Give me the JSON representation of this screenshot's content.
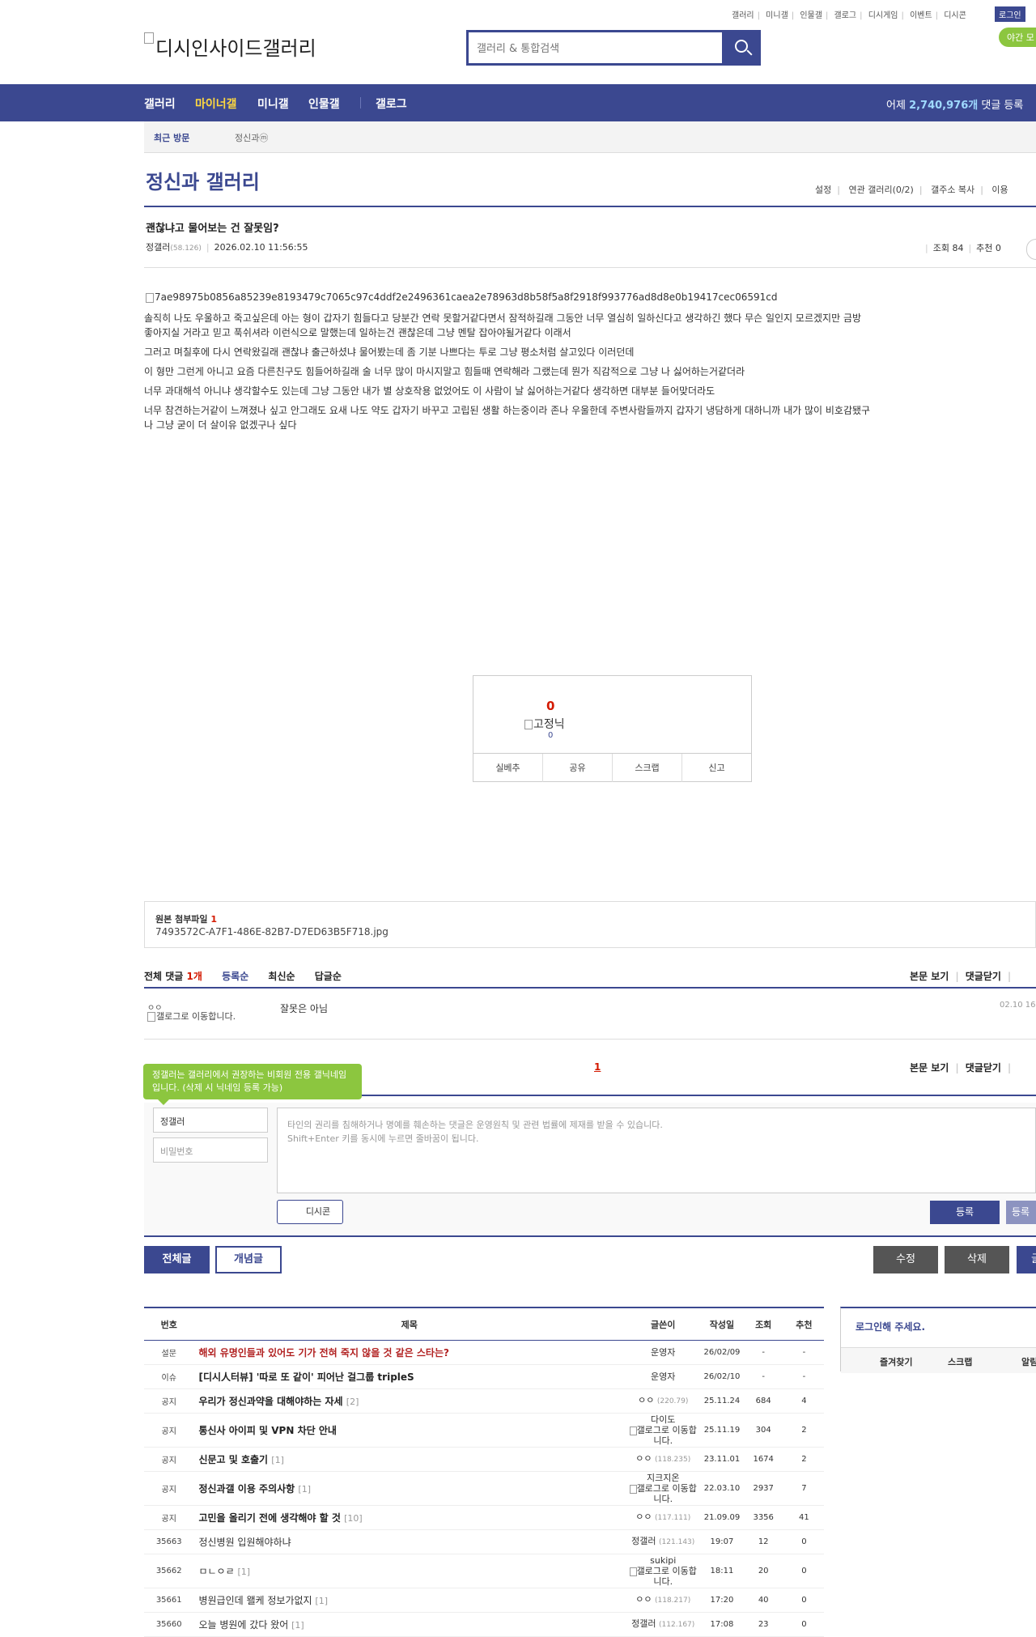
{
  "top_links": [
    "갤러리",
    "미니갤",
    "인물갤",
    "갤로그",
    "디시게임",
    "이벤트",
    "디시콘"
  ],
  "login_label": "로그인",
  "night_mode_label": "야간 모",
  "logo_alt": "디시인사이드갤러리",
  "search": {
    "placeholder": "갤러리 & 통합검색"
  },
  "nav": {
    "items": [
      "갤러리",
      "마이너갤",
      "미니갤",
      "인물갤",
      "갤로그"
    ],
    "active": "마이너갤",
    "stat_prefix": "어제",
    "stat_number": "2,740,976",
    "stat_unit": "개",
    "stat_suffix": "댓글 등록"
  },
  "recent_visit": {
    "label": "최근 방문",
    "item": "정신과ⓜ"
  },
  "gallery": {
    "title": "정신과 갤러리",
    "options": [
      "설정",
      "연관 갤러리(0/2)",
      "갤주소 복사",
      "이용"
    ]
  },
  "post": {
    "title": "괜찮냐고 물어보는 건 잘못임?",
    "author": "정갤러",
    "author_ip": "(58.126)",
    "datetime": "2026.02.10 11:56:55",
    "views_label": "조회 84",
    "recommend_label": "추천 0",
    "image_alt": "7ae98975b0856a85239e8193479c7065c97c4ddf2e2496361caea2e78963d8b58f5a8f2918f993776ad8d8e0b19417cec06591cd",
    "paragraphs": [
      "솔직히 나도 우울하고 죽고싶은데 아는 형이 갑자기 힘들다고 당분간 연락 못할거같다면서 잠적하길래 그동안 너무 열심히 일하신다고 생각하긴 했다 무슨 일인지 모르겠지만 금방 좋아지실 거라고 믿고 푹쉬셔라 이런식으로 말했는데 일하는건 괜찮은데 그냥 멘탈 잡아야될거같다 이래서",
      "그러고 며칠후에 다시 연락왔길래 괜찮냐 출근하셨냐 물어봤는데 좀 기분 나쁘다는 투로 그냥 평소처럼 살고있다 이러던데",
      "이 형만 그런게 아니고 요즘 다른친구도 힘들어하길래 술 너무 많이 마시지말고 힘들때 연락해라 그랬는데 뭔가 직감적으로 그냥 나 싫어하는거같더라",
      "너무 과대해석 아니냐 생각할수도 있는데 그냥 그동안 내가 별 상호작용 없었어도 이 사람이 날 싫어하는거같다 생각하면 대부분 들어맞더라도",
      "너무 참견하는거같이 느껴졌나 싶고 안그래도 요새 나도 약도 갑자기 바꾸고 고립된 생활 하는중이라 존나 우울한데 주변사람들까지 갑자기 냉담하게 대하니까 내가 많이 비호감됐구나 그냥 굳이 더 살이유 없겠구나 싶다"
    ]
  },
  "recommend": {
    "count": "0",
    "fixed_alt": "고정닉",
    "fixed_count": "0",
    "buttons": [
      "실베추",
      "공유",
      "스크랩",
      "신고"
    ]
  },
  "attachment": {
    "label": "원본 첨부파일",
    "count": "1",
    "filename": "7493572C-A7F1-486E-82B7-D7ED63B5F718.jpg"
  },
  "comments": {
    "total_label": "전체 댓글",
    "total_count": "1개",
    "sorts": [
      "등록순",
      "최신순",
      "답글순"
    ],
    "right_actions": [
      "본문 보기",
      "댓글닫기"
    ],
    "items": [
      {
        "nick": "ㅇㅇ",
        "img_alt": "갤로그로 이동합니다.",
        "text": "잘못은 아님",
        "date": "02.10 16"
      }
    ],
    "page": "1"
  },
  "write": {
    "tip": "정갤러는 갤러리에서 권장하는 비회원 전용 갤닉네임입니다. (삭제 시 닉네임 등록 가능)",
    "nick_value": "정갤러",
    "pw_placeholder": "비밀번호",
    "textarea_line1": "타인의 권리를 침해하거나 명예를 훼손하는 댓글은 운영원칙 및 관련 법률에 제재를 받을 수 있습니다.",
    "textarea_line2": "Shift+Enter 키를 동시에 누르면 줄바꿈이 됩니다.",
    "dccon_label": "디시콘",
    "submit_label": "등록",
    "submit2_label": "등록"
  },
  "list_buttons": {
    "all": "전체글",
    "concept": "개념글",
    "edit": "수정",
    "delete": "삭제",
    "write": "글"
  },
  "list": {
    "headers": [
      "번호",
      "제목",
      "글쓴이",
      "작성일",
      "조회",
      "추천"
    ],
    "rows": [
      {
        "num": "설문",
        "title": "해외 유명인들과 있어도 기가 전혀 죽지 않을 것 같은 스타는?",
        "reply": "",
        "writer": "운영자",
        "ip": "",
        "img_alt": "",
        "date": "26/02/09",
        "views": "-",
        "rec": "-",
        "notice": true,
        "red": true
      },
      {
        "num": "이슈",
        "title": "[디시人터뷰] '따로 또 같이' 피어난 걸그룹 tripleS",
        "reply": "",
        "writer": "운영자",
        "ip": "",
        "img_alt": "",
        "date": "26/02/10",
        "views": "-",
        "rec": "-",
        "notice": true,
        "red": false
      },
      {
        "num": "공지",
        "title": "우리가 정신과약을 대해야하는 자세",
        "reply": "[2]",
        "writer": "ㅇㅇ",
        "ip": "(220.79)",
        "img_alt": "",
        "date": "25.11.24",
        "views": "684",
        "rec": "4",
        "notice": true,
        "red": false
      },
      {
        "num": "공지",
        "title": "통신사 아이피 및 VPN 차단 안내",
        "reply": "",
        "writer": "다이도",
        "ip": "",
        "img_alt": "갤로그로 이동합니다.",
        "date": "25.11.19",
        "views": "304",
        "rec": "2",
        "notice": true,
        "red": false
      },
      {
        "num": "공지",
        "title": "신문고 및 호출기",
        "reply": "[1]",
        "writer": "ㅇㅇ",
        "ip": "(118.235)",
        "img_alt": "",
        "date": "23.11.01",
        "views": "1674",
        "rec": "2",
        "notice": true,
        "red": false
      },
      {
        "num": "공지",
        "title": "정신과갤 이용 주의사항",
        "reply": "[1]",
        "writer": "지크지온",
        "ip": "",
        "img_alt": "갤로그로 이동합니다.",
        "date": "22.03.10",
        "views": "2937",
        "rec": "7",
        "notice": true,
        "red": false
      },
      {
        "num": "공지",
        "title": "고민을 올리기 전에 생각해야 할 것",
        "reply": "[10]",
        "writer": "ㅇㅇ",
        "ip": "(117.111)",
        "img_alt": "",
        "date": "21.09.09",
        "views": "3356",
        "rec": "41",
        "notice": true,
        "red": false
      },
      {
        "num": "35663",
        "title": "정신병원 입원해야하냐",
        "reply": "",
        "writer": "정갤러",
        "ip": "(121.143)",
        "img_alt": "",
        "date": "19:07",
        "views": "12",
        "rec": "0",
        "notice": false,
        "red": false
      },
      {
        "num": "35662",
        "title": "ㅁㄴㅇㄹ",
        "reply": "[1]",
        "writer": "sukipi",
        "ip": "",
        "img_alt": "갤로그로 이동합니다.",
        "date": "18:11",
        "views": "20",
        "rec": "0",
        "notice": false,
        "red": false
      },
      {
        "num": "35661",
        "title": "병원급인데 왤케 정보가없지",
        "reply": "[1]",
        "writer": "ㅇㅇ",
        "ip": "(118.217)",
        "img_alt": "",
        "date": "17:20",
        "views": "40",
        "rec": "0",
        "notice": false,
        "red": false
      },
      {
        "num": "35660",
        "title": "오늘 병원에 갔다 왔어",
        "reply": "[1]",
        "writer": "정갤러",
        "ip": "(112.167)",
        "img_alt": "",
        "date": "17:08",
        "views": "23",
        "rec": "0",
        "notice": false,
        "red": false
      }
    ]
  },
  "sidebox": {
    "title": "로그인해 주세요.",
    "actions": [
      "즐겨찾기",
      "스크랩",
      "알림"
    ]
  },
  "colors": {
    "brand": "#3b4890",
    "highlight": "#ffd83f",
    "green": "#8cc63f",
    "red": "#d31900"
  }
}
